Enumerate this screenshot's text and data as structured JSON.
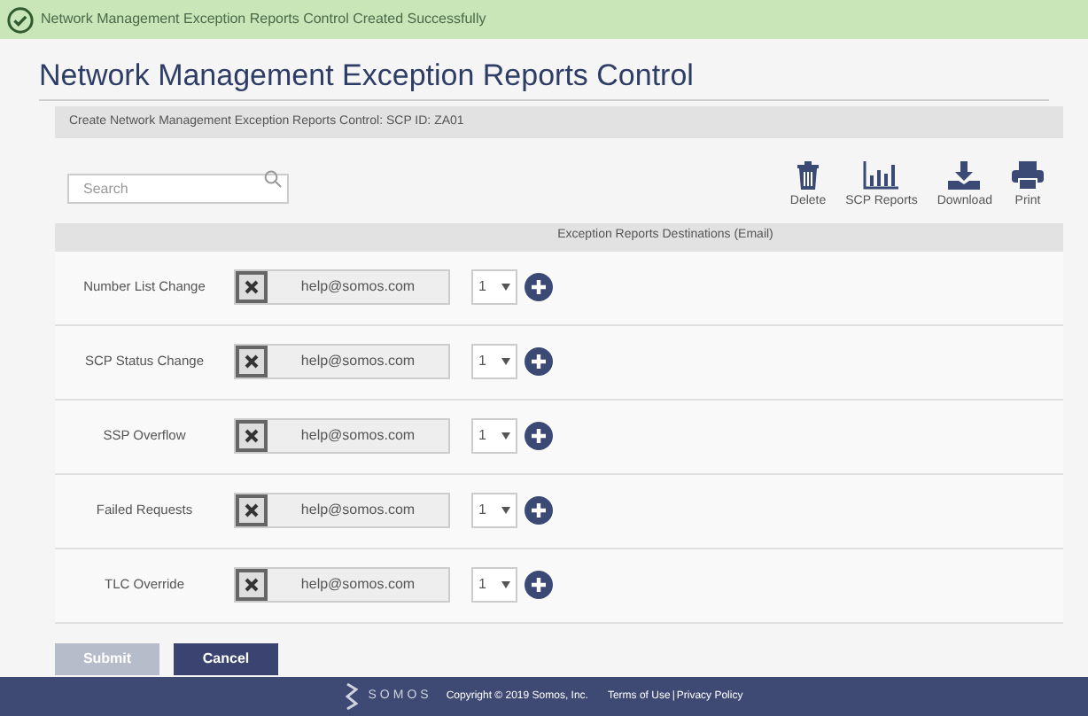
{
  "banner": {
    "message": "Network Management Exception Reports Control Created Successfully"
  },
  "title": "Network Management Exception Reports Control",
  "subheader": "Create Network Management Exception Reports Control: SCP ID: ZA01",
  "search": {
    "placeholder": "Search"
  },
  "toolbar": [
    {
      "kind": "delete",
      "label": "Delete"
    },
    {
      "kind": "reports",
      "label": "SCP Reports"
    },
    {
      "kind": "download",
      "label": "Download"
    },
    {
      "kind": "print",
      "label": "Print"
    }
  ],
  "table": {
    "header": "Exception Reports Destinations (Email)",
    "rows": [
      {
        "label": "Number List Change",
        "email": "help@somos.com",
        "count": "1"
      },
      {
        "label": "SCP Status Change",
        "email": "help@somos.com",
        "count": "1"
      },
      {
        "label": "SSP Overflow",
        "email": "help@somos.com",
        "count": "1"
      },
      {
        "label": "Failed Requests",
        "email": "help@somos.com",
        "count": "1"
      },
      {
        "label": "TLC Override",
        "email": "help@somos.com",
        "count": "1"
      }
    ]
  },
  "buttons": [
    {
      "label": "Submit",
      "disabled": true
    },
    {
      "label": "Cancel",
      "disabled": false
    }
  ],
  "footer": {
    "brand": "SOMOS",
    "copyright": "Copyright © 2019 Somos, Inc.",
    "links": [
      "Terms of Use",
      "Privacy Policy"
    ],
    "separator": "|"
  }
}
